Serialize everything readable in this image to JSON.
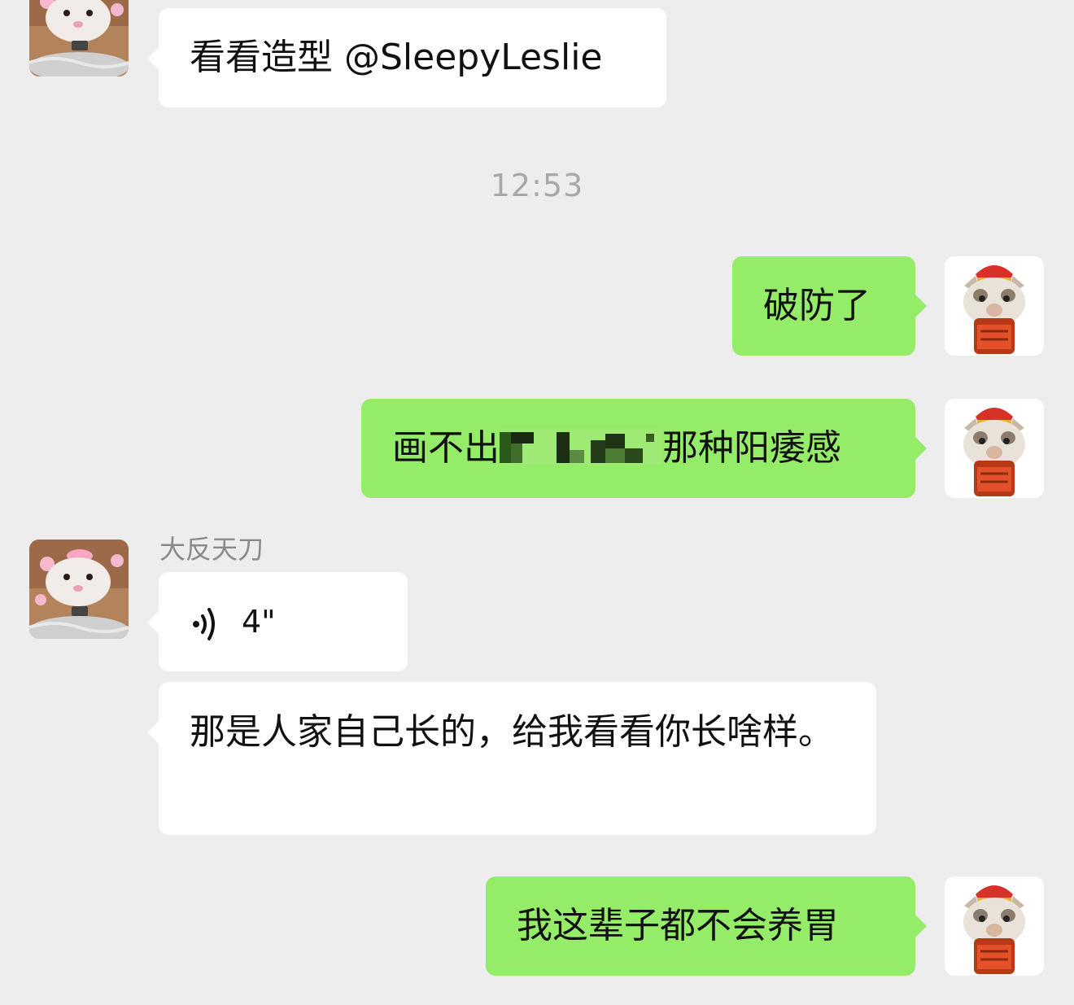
{
  "chat": {
    "timestamp": "12:53",
    "messages": [
      {
        "side": "incoming",
        "text": "看看造型 @SleepyLeslie"
      },
      {
        "side": "outgoing",
        "text": "破防了"
      },
      {
        "side": "outgoing",
        "text_prefix": "画不出",
        "text_suffix": "那种阳痿感",
        "redacted": true
      },
      {
        "side": "incoming",
        "sender": "大反天刀",
        "type": "voice",
        "duration": "4\""
      },
      {
        "side": "incoming",
        "text": "那是人家自己长的，给我看看你长啥样。"
      },
      {
        "side": "outgoing",
        "text": "我这辈子都不会养胃"
      }
    ]
  },
  "colors": {
    "background": "#ededed",
    "incoming_bubble": "#ffffff",
    "outgoing_bubble": "#95ec69",
    "timestamp": "#a8a8a8",
    "sender_name": "#8a8a8a"
  },
  "icons": {
    "incoming_avatar": "rat-avatar",
    "outgoing_avatar": "cat-avatar",
    "voice": "voice-wave-icon"
  }
}
